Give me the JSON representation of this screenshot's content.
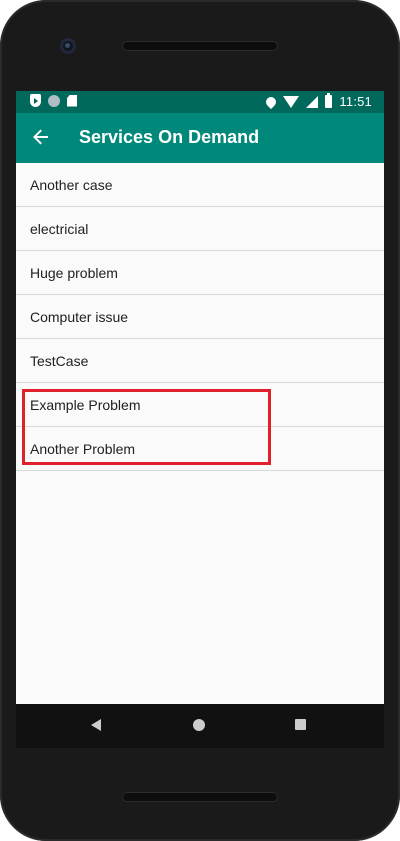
{
  "status_bar": {
    "time": "11:51",
    "icons": [
      "shield-icon",
      "circle-icon",
      "sd-card-icon",
      "location-icon",
      "wifi-icon",
      "signal-icon",
      "battery-icon"
    ]
  },
  "app_bar": {
    "title": "Services On Demand",
    "back_icon": "arrow-back-icon"
  },
  "list": {
    "items": [
      {
        "label": "Another case"
      },
      {
        "label": "electricial"
      },
      {
        "label": "Huge problem"
      },
      {
        "label": "Computer issue"
      },
      {
        "label": "TestCase"
      },
      {
        "label": "Example Problem"
      },
      {
        "label": "Another Problem"
      }
    ]
  },
  "nav_bar": {
    "icons": [
      "nav-back-icon",
      "nav-home-icon",
      "nav-recents-icon"
    ]
  },
  "colors": {
    "status_bar": "#00695c",
    "app_bar": "#00897b",
    "highlight": "#e0202a"
  }
}
